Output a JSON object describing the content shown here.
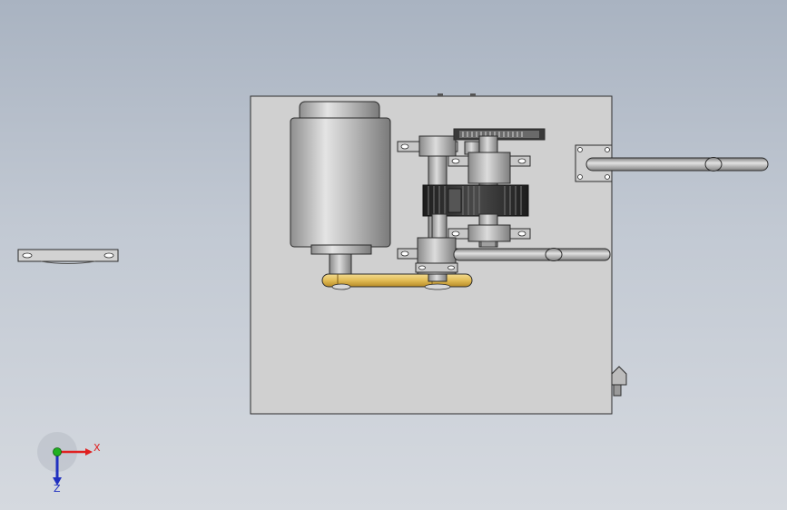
{
  "viewport": {
    "background_top": "#a9b3c1",
    "background_bottom": "#d5d9df"
  },
  "model": {
    "plate_color": "#d0d0d0",
    "metal_color": "#b8b8b8",
    "gear_color": "#2a2a2a",
    "belt_color": "#e8c868",
    "edge_color": "#2b2b2b"
  },
  "triad": {
    "x_label": "X",
    "z_label": "Z",
    "x_color": "#e02020",
    "z_color": "#2030c0",
    "y_color": "#20b020"
  }
}
